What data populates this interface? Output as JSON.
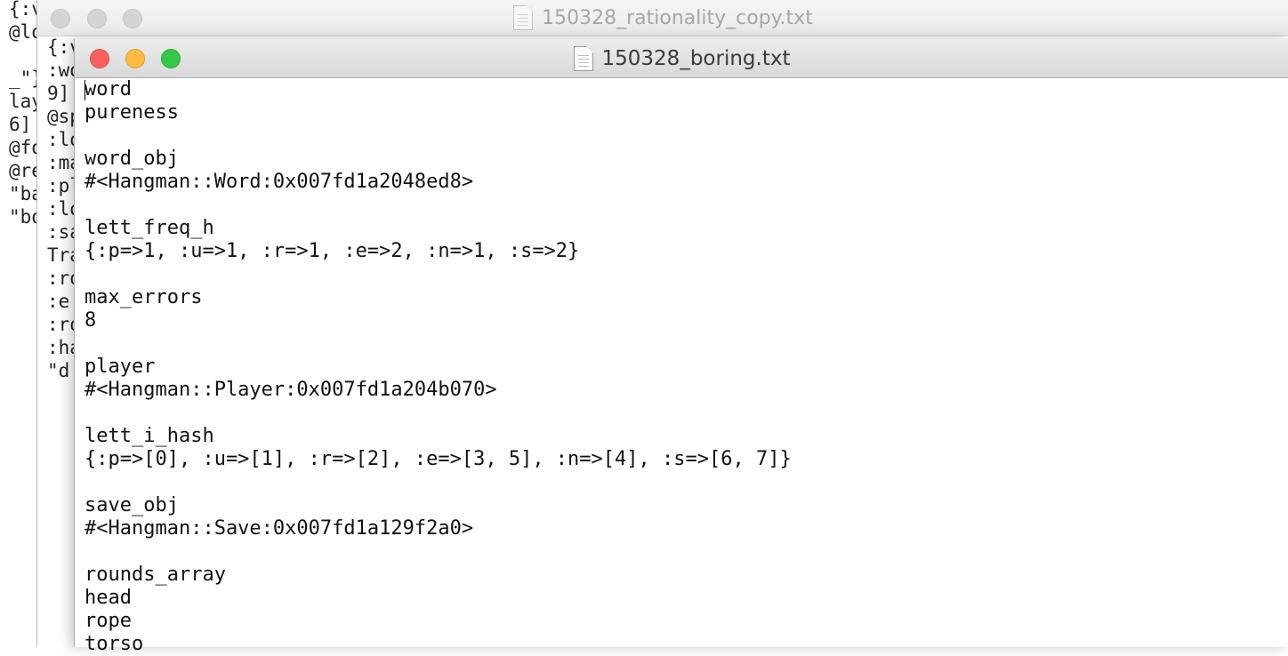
{
  "back_window": {
    "lines": [
      "{:v",
      "@lo",
      "",
      "_\"}",
      "lay",
      "6]",
      "@fo",
      "@re",
      "\"ba",
      "\"bo"
    ]
  },
  "middle_window": {
    "title": "150328_rationality_copy.txt",
    "lines": [
      "{:v",
      ":wo",
      "9]",
      "@sp",
      ":lo",
      ":ma",
      ":pl",
      ":lo",
      ":sa",
      "Tra",
      ":ro",
      ":e",
      ":ro",
      ":ha",
      "\"d"
    ]
  },
  "front_window": {
    "title": "150328_boring.txt",
    "lines": [
      "word",
      "pureness",
      "",
      "word_obj",
      "#<Hangman::Word:0x007fd1a2048ed8>",
      "",
      "lett_freq_h",
      "{:p=>1, :u=>1, :r=>1, :e=>2, :n=>1, :s=>2}",
      "",
      "max_errors",
      "8",
      "",
      "player",
      "#<Hangman::Player:0x007fd1a204b070>",
      "",
      "lett_i_hash",
      "{:p=>[0], :u=>[1], :r=>[2], :e=>[3, 5], :n=>[4], :s=>[6, 7]}",
      "",
      "save_obj",
      "#<Hangman::Save:0x007fd1a129f2a0>",
      "",
      "rounds_array",
      "head",
      "rope",
      "torso"
    ]
  },
  "colors": {
    "close": "#fc605c",
    "minimize": "#fdbc40",
    "zoom": "#34c84a",
    "inactive_light": "#d4d4d4"
  }
}
